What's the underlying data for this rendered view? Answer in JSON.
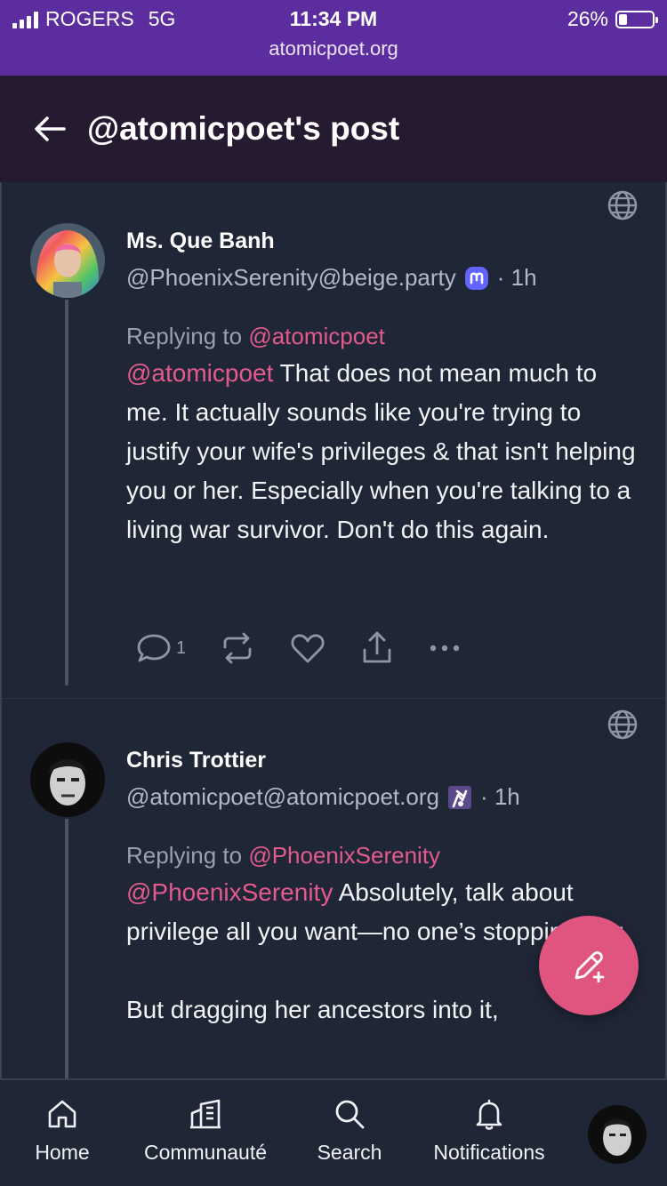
{
  "status_bar": {
    "carrier": "ROGERS",
    "network": "5G",
    "time": "11:34 PM",
    "url": "atomicpoet.org",
    "battery": "26%",
    "battery_level": 0.26
  },
  "header": {
    "back_icon": "arrow-left-icon",
    "title": "@atomicpoet's post"
  },
  "posts": [
    {
      "display_name": "Ms. Que Banh",
      "handle": "@PhoenixSerenity@beige.party",
      "server_badge": "mastodon-icon",
      "time": "· 1h",
      "replying_label": "Replying to",
      "replying_to": "@atomicpoet",
      "mention": "@atomicpoet",
      "text": " That does not mean much to me. It actually sounds like you're trying to justify your wife's privileges & that isn't helping you or her. Especially when you're talking to a living war survivor. Don't do this again.",
      "reply_count": "1",
      "visibility_icon": "globe-icon"
    },
    {
      "display_name": "Chris Trottier",
      "handle": "@atomicpoet@atomicpoet.org",
      "server_badge": "akkoma-icon",
      "time": "· 1h",
      "replying_label": "Replying to",
      "replying_to": "@PhoenixSerenity",
      "mention": "@PhoenixSerenity",
      "text": " Absolutely, talk about privilege all you want—no one’s stopping you.",
      "text_2": "But dragging her ancestors into it,",
      "visibility_icon": "globe-icon"
    }
  ],
  "compose_button": {
    "icon": "compose-pencil-icon"
  },
  "tabbar": {
    "items": [
      {
        "label": "Home",
        "icon": "home-icon"
      },
      {
        "label": "Communauté",
        "icon": "community-building-icon"
      },
      {
        "label": "Search",
        "icon": "search-icon"
      },
      {
        "label": "Notifications",
        "icon": "bell-icon"
      }
    ],
    "profile_icon": "avatar"
  },
  "colors": {
    "status_bar": "#5b2d9e",
    "header": "#261a30",
    "background": "#1f2636",
    "mention": "#e45a8f",
    "fab": "#e0557f"
  }
}
